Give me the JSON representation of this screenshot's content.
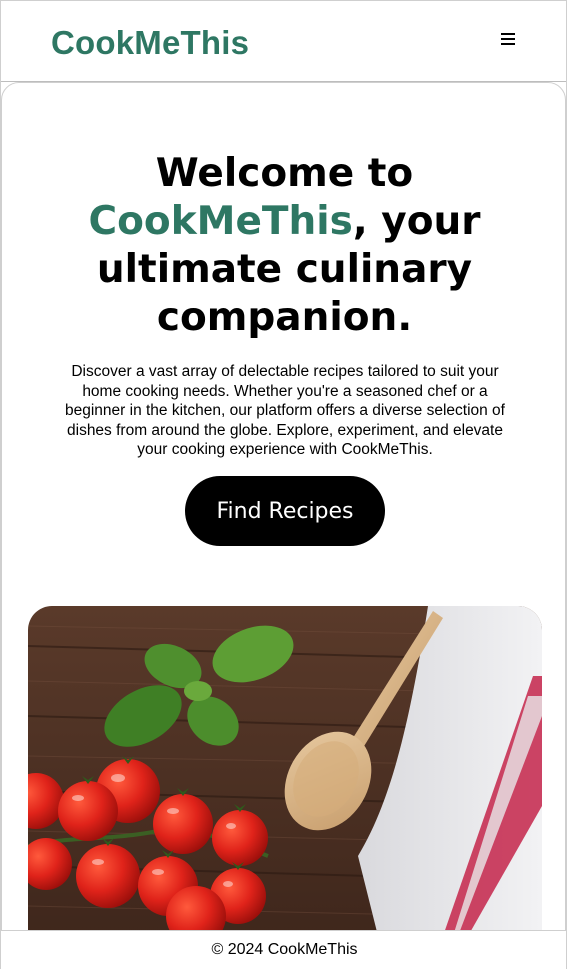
{
  "header": {
    "brand": "CookMeThis",
    "menu_icon": "hamburger-menu-icon"
  },
  "hero": {
    "title_prefix": "Welcome to",
    "title_brand": "CookMeThis",
    "title_suffix": ", your ultimate culinary companion.",
    "description": "Discover a vast array of delectable recipes tailored to suit your home cooking needs. Whether you're a seasoned chef or a beginner in the kitchen, our platform offers a diverse selection of dishes from around the globe. Explore, experiment, and elevate your cooking experience with CookMeThis.",
    "cta_label": "Find Recipes"
  },
  "footer": {
    "copyright": "© 2024 CookMeThis"
  },
  "colors": {
    "brand": "#2e7763",
    "button_bg": "#000000",
    "button_text": "#ffffff"
  }
}
